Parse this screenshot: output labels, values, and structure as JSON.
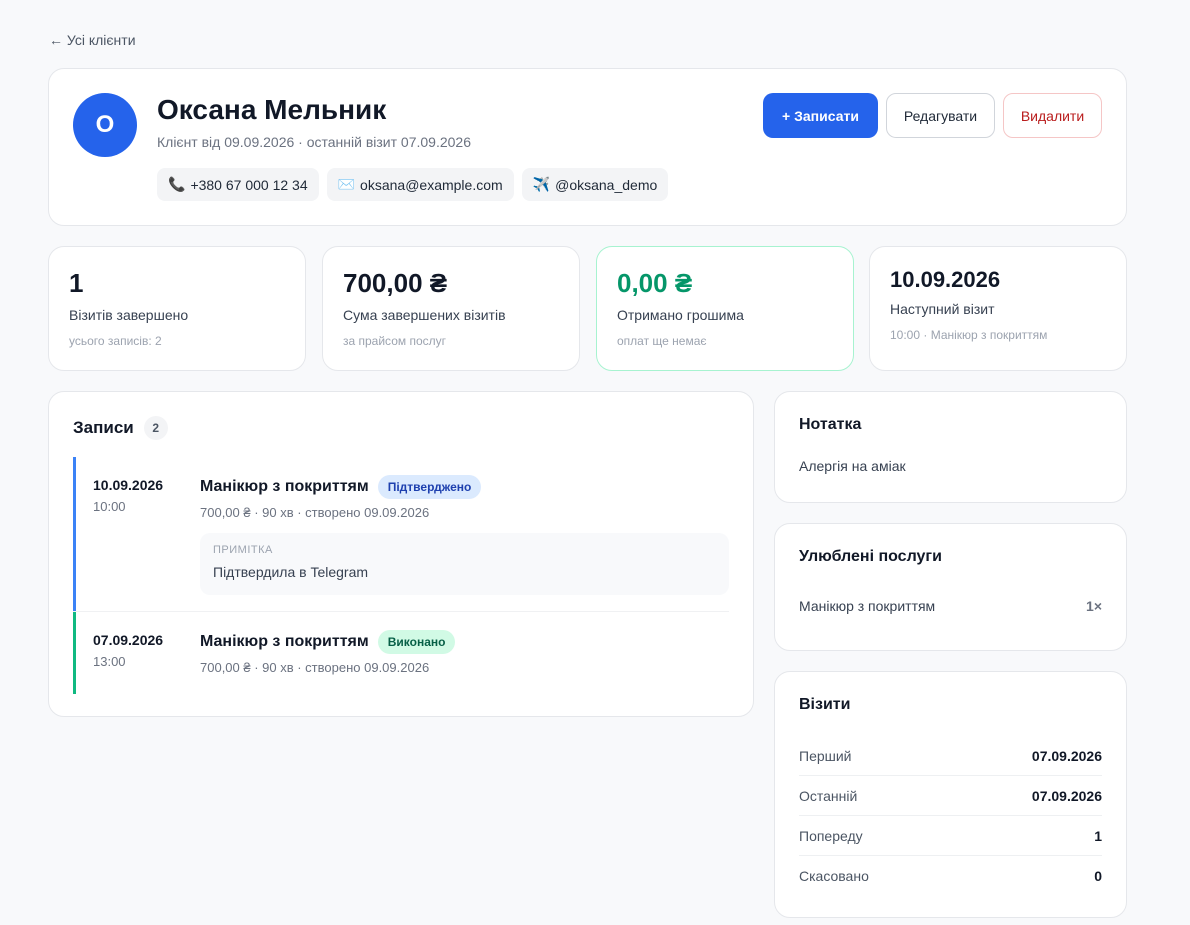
{
  "nav": {
    "back_label": "← Усі клієнти"
  },
  "client": {
    "initial": "О",
    "name": "Оксана Мельник",
    "subtitle": "Клієнт від 09.09.2026 · останній візит 07.09.2026",
    "contacts": [
      {
        "icon": "phone-icon",
        "glyph": "📞",
        "text": "+380 67 000 12 34"
      },
      {
        "icon": "email-icon",
        "glyph": "✉️",
        "text": "oksana@example.com"
      },
      {
        "icon": "telegram-icon",
        "glyph": "✈️",
        "text": "@oksana_demo"
      }
    ]
  },
  "actions": {
    "book_label": "+ Записати",
    "edit_label": "Редагувати",
    "delete_label": "Видалити"
  },
  "stats": [
    {
      "value": "1",
      "label": "Візитів завершено",
      "hint": "усього записів: 2"
    },
    {
      "value": "700,00 ₴",
      "label": "Сума завершених візитів",
      "hint": "за прайсом послуг"
    },
    {
      "value": "0,00 ₴",
      "label": "Отримано грошима",
      "hint": "оплат ще немає"
    },
    {
      "value": "10.09.2026",
      "label": "Наступний візит",
      "hint": "10:00 · Манікюр з покриттям"
    }
  ],
  "records": {
    "title": "Записи",
    "count": "2",
    "items": [
      {
        "date": "10.09.2026",
        "time": "10:00",
        "service": "Манікюр з покриттям",
        "status": "Підтверджено",
        "meta": "700,00 ₴ · 90 хв · створено 09.09.2026",
        "note_label": "ПРИМІТКА",
        "note": "Підтвердила в Telegram"
      },
      {
        "date": "07.09.2026",
        "time": "13:00",
        "service": "Манікюр з покриттям",
        "status": "Виконано",
        "meta": "700,00 ₴ · 90 хв · створено 09.09.2026"
      }
    ]
  },
  "note": {
    "title": "Нотатка",
    "text": "Алергія на аміак"
  },
  "favorites": {
    "title": "Улюблені послуги",
    "items": [
      {
        "name": "Манікюр з покриттям",
        "count": "1×"
      }
    ]
  },
  "visits": {
    "title": "Візити",
    "rows": [
      {
        "label": "Перший",
        "value": "07.09.2026"
      },
      {
        "label": "Останній",
        "value": "07.09.2026"
      },
      {
        "label": "Попереду",
        "value": "1"
      },
      {
        "label": "Скасовано",
        "value": "0"
      }
    ]
  },
  "colors": {
    "accent": "#2563eb",
    "success": "#059669",
    "danger": "#b91c1c",
    "confirmed_bar": "#3b82f6",
    "done_bar": "#10b981"
  }
}
